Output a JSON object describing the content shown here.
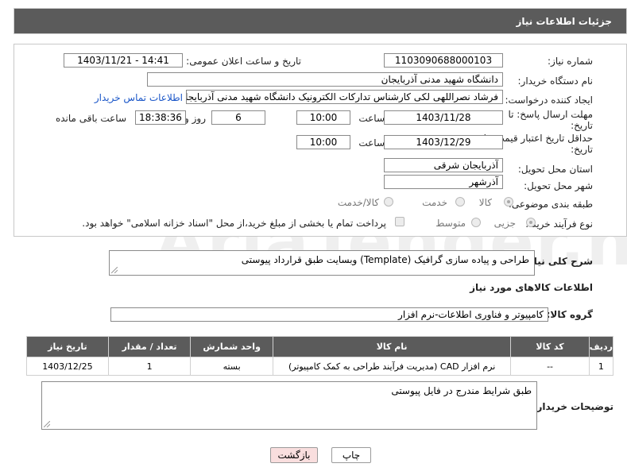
{
  "header": {
    "title": "جزئیات اطلاعات نیاز"
  },
  "fields": {
    "need_number_label": "شماره نیاز:",
    "need_number": "1103090688000103",
    "announce_label": "تاریخ و ساعت اعلان عمومی:",
    "announce_value": "1403/11/21 - 14:41",
    "buyer_org_label": "نام دستگاه خریدار:",
    "buyer_org": "دانشگاه شهید مدنی آذربایجان",
    "requester_label": "ایجاد کننده درخواست:",
    "requester": "فرشاد نصراللهی لکی کارشناس تدارکات الکترونیک دانشگاه شهید مدنی آذربایجان",
    "contact_link": "اطلاعات تماس خریدار",
    "deadline_label_1": "مهلت ارسال پاسخ: تا",
    "deadline_label_2": "تاریخ:",
    "deadline_date": "1403/11/28",
    "time_label": "ساعت",
    "deadline_time": "10:00",
    "days_value": "6",
    "days_label": "روز و",
    "remaining_time": "18:38:36",
    "remaining_label": "ساعت باقی مانده",
    "validity_label_1": "حداقل تاریخ اعتبار قیمت: تا",
    "validity_label_2": "تاریخ:",
    "validity_date": "1403/12/29",
    "validity_time_label": "ساعت",
    "validity_time": "10:00",
    "province_label": "استان محل تحویل:",
    "province": "آذربایجان شرقی",
    "city_label": "شهر محل تحویل:",
    "city": "آذرشهر",
    "category_label": "طبقه بندی موضوعی:",
    "category_options": [
      "کالا",
      "خدمت",
      "کالا/خدمت"
    ],
    "process_label": "نوع فرآیند خرید :",
    "process_options": [
      "جزیی",
      "متوسط"
    ],
    "payment_note": "پرداخت تمام یا بخشی از مبلغ خرید،از محل \"اسناد خزانه اسلامی\" خواهد بود."
  },
  "description": {
    "label": "شرح کلی نیاز:",
    "value": "طراحی و پیاده سازی گرافیک (Template) وبسایت طبق قرارداد پیوستی"
  },
  "goods_section": {
    "title": "اطلاعات کالاهای مورد نیاز",
    "group_label": "گروه کالا:",
    "group_value": "کامپیوتر و فناوری اطلاعات-نرم افزار"
  },
  "table": {
    "headers": [
      "ردیف",
      "کد کالا",
      "نام کالا",
      "واحد شمارش",
      "تعداد / مقدار",
      "تاریخ نیاز"
    ],
    "rows": [
      [
        "1",
        "--",
        "نرم افزار CAD (مدیریت فرآیند طراحی به کمک کامپیوتر)",
        "بسته",
        "1",
        "1403/12/25"
      ]
    ]
  },
  "buyer_notes": {
    "label": "توضیحات خریدار:",
    "value": "طبق شرایط مندرج در فایل پیوستی"
  },
  "buttons": {
    "print": "چاپ",
    "back": "بازگشت"
  },
  "watermark": "AriaTender.net",
  "colors": {
    "header_bg": "#5b5b5b",
    "link": "#1a56c8",
    "back_btn_bg": "#f9dede"
  }
}
